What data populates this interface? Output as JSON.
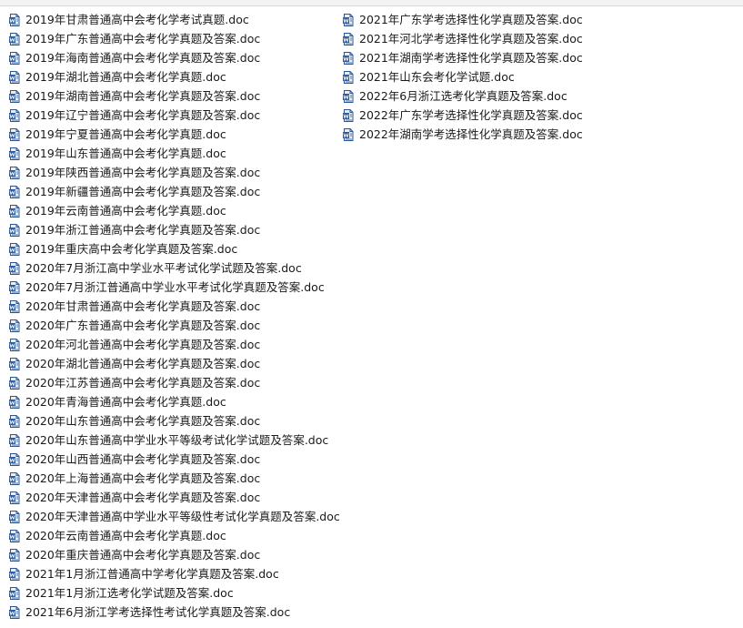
{
  "files": {
    "left": [
      "2019年甘肃普通高中会考化学考试真题.doc",
      "2019年广东普通高中会考化学真题及答案.doc",
      "2019年海南普通高中会考化学真题及答案.doc",
      "2019年湖北普通高中会考化学真题.doc",
      "2019年湖南普通高中会考化学真题及答案.doc",
      "2019年辽宁普通高中会考化学真题及答案.doc",
      "2019年宁夏普通高中会考化学真题.doc",
      "2019年山东普通高中会考化学真题.doc",
      "2019年陕西普通高中会考化学真题及答案.doc",
      "2019年新疆普通高中会考化学真题及答案.doc",
      "2019年云南普通高中会考化学真题.doc",
      "2019年浙江普通高中会考化学真题及答案.doc",
      "2019年重庆高中会考化学真题及答案.doc",
      "2020年7月浙江高中学业水平考试化学试题及答案.doc",
      "2020年7月浙江普通高中学业水平考试化学真题及答案.doc",
      "2020年甘肃普通高中会考化学真题及答案.doc",
      "2020年广东普通高中会考化学真题及答案.doc",
      "2020年河北普通高中会考化学真题及答案.doc",
      "2020年湖北普通高中会考化学真题及答案.doc",
      "2020年江苏普通高中会考化学真题及答案.doc",
      "2020年青海普通高中会考化学真题.doc",
      "2020年山东普通高中会考化学真题及答案.doc",
      "2020年山东普通高中学业水平等级考试化学试题及答案.doc",
      "2020年山西普通高中会考化学真题及答案.doc",
      "2020年上海普通高中会考化学真题及答案.doc",
      "2020年天津普通高中会考化学真题及答案.doc",
      "2020年天津普通高中学业水平等级性考试化学真题及答案.doc",
      "2020年云南普通高中会考化学真题.doc",
      "2020年重庆普通高中会考化学真题及答案.doc",
      "2021年1月浙江普通高中学考化学真题及答案.doc",
      "2021年1月浙江选考化学试题及答案.doc",
      "2021年6月浙江学考选择性考试化学真题及答案.doc"
    ],
    "right": [
      "2021年广东学考选择性化学真题及答案.doc",
      "2021年河北学考选择性化学真题及答案.doc",
      "2021年湖南学考选择性化学真题及答案.doc",
      "2021年山东会考化学试题.doc",
      "2022年6月浙江选考化学真题及答案.doc",
      "2022年广东学考选择性化学真题及答案.doc",
      "2022年湖南学考选择性化学真题及答案.doc"
    ]
  },
  "icon": "word-doc-icon",
  "colors": {
    "icon_blue": "#2b5797",
    "icon_page": "#e8eef8"
  }
}
